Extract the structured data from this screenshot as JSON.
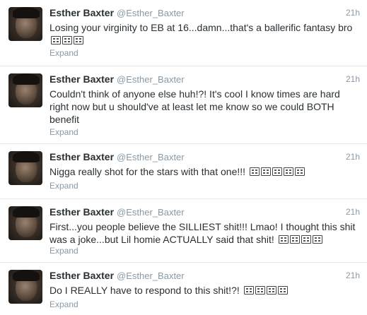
{
  "tweets": [
    {
      "name": "Esther Baxter",
      "handle": "@Esther_Baxter",
      "time": "21h",
      "text": "Losing your virginity to EB at 16...damn...that's a ballerific fantasy bro",
      "emoji": [
        "👀",
        "😏",
        "😏"
      ],
      "expand": "Expand"
    },
    {
      "name": "Esther Baxter",
      "handle": "@Esther_Baxter",
      "time": "21h",
      "text": "Couldn't think of anyone else huh!?! It's cool I know times are hard right now but u should've at least let me know so we could BOTH benefit",
      "emoji": [],
      "expand": "Expand"
    },
    {
      "name": "Esther Baxter",
      "handle": "@Esther_Baxter",
      "time": "21h",
      "text": "Nigga really shot for the stars with that one!!!",
      "emoji": [
        "😂",
        "😂",
        "😂",
        "😂",
        "😂"
      ],
      "expand": "Expand"
    },
    {
      "name": "Esther Baxter",
      "handle": "@Esther_Baxter",
      "time": "21h",
      "text": "First...you people believe the SILLIEST shit!!! Lmao! I thought this shit was a joke...but Lil homie ACTUALLY said that shit!",
      "emoji": [
        "😂",
        "😂",
        "😂",
        "😂"
      ],
      "expand": "Expand"
    },
    {
      "name": "Esther Baxter",
      "handle": "@Esther_Baxter",
      "time": "21h",
      "text": "Do I REALLY have to respond to this shit!?!",
      "emoji": [
        "😂",
        "😂",
        "😂",
        "😂"
      ],
      "expand": "Expand"
    }
  ]
}
